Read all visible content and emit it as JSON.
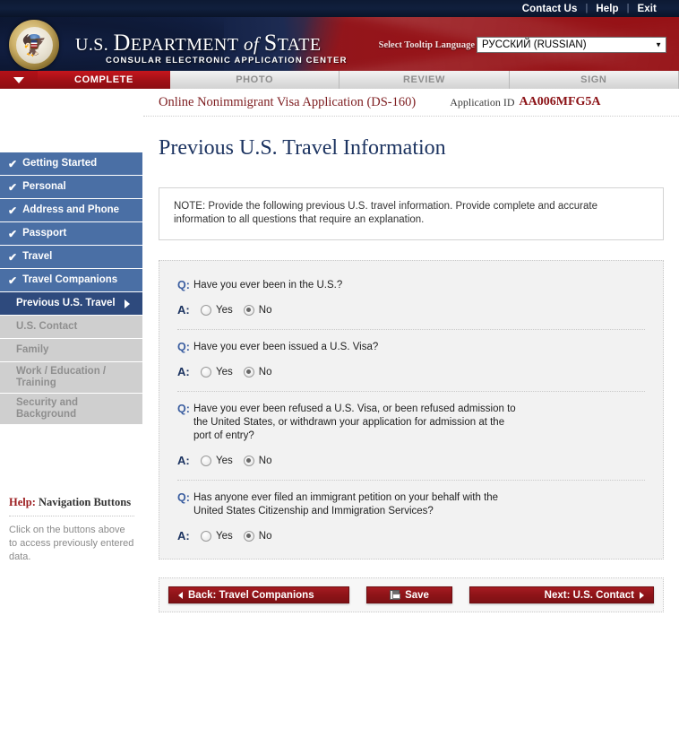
{
  "topbar": {
    "links": [
      "Contact Us",
      "Help",
      "Exit"
    ],
    "separator": "|"
  },
  "banner": {
    "title_prefix": "U.S. ",
    "title_department": "D",
    "title_department_rest": "EPARTMENT",
    "title_of": " of ",
    "title_state": "S",
    "title_state_rest": "TATE",
    "subtitle": "CONSULAR ELECTRONIC APPLICATION CENTER",
    "seal_icon": "great-seal-icon",
    "language_label": "Select Tooltip Language",
    "language_value": "РУССКИЙ (RUSSIAN)",
    "dropdown_icon": "chevron-down-icon"
  },
  "tabs": {
    "arrow_icon": "triangle-down-icon",
    "items": [
      {
        "label": "COMPLETE",
        "active": true
      },
      {
        "label": "PHOTO",
        "active": false
      },
      {
        "label": "REVIEW",
        "active": false
      },
      {
        "label": "SIGN",
        "active": false
      }
    ]
  },
  "sidebar": {
    "items": [
      {
        "label": "Getting Started",
        "state": "done"
      },
      {
        "label": "Personal",
        "state": "done"
      },
      {
        "label": "Address and Phone",
        "state": "done"
      },
      {
        "label": "Passport",
        "state": "done"
      },
      {
        "label": "Travel",
        "state": "done"
      },
      {
        "label": "Travel Companions",
        "state": "done"
      },
      {
        "label": "Previous U.S. Travel",
        "state": "active"
      },
      {
        "label": "U.S. Contact",
        "state": "todo"
      },
      {
        "label": "Family",
        "state": "todo"
      },
      {
        "label": "Work / Education / Training",
        "state": "todo"
      },
      {
        "label": "Security and Background",
        "state": "todo"
      }
    ],
    "check_glyph": "✔",
    "caret_icon": "caret-right-icon"
  },
  "help": {
    "title_prefix": "Help: ",
    "title_rest": "Navigation Buttons",
    "body": "Click on the buttons above to access previously entered data."
  },
  "header": {
    "app_name": "Online Nonimmigrant Visa Application (DS-160)",
    "app_id_label": "Application ID",
    "app_id_value": "AA006MFG5A"
  },
  "page": {
    "title": "Previous U.S. Travel Information",
    "note": "NOTE: Provide the following previous U.S. travel information. Provide complete and accurate information to all questions that require an explanation."
  },
  "questions": [
    {
      "q_marker": "Q:",
      "a_marker": "A:",
      "text": "Have you ever been in the U.S.?",
      "options": [
        {
          "label": "Yes",
          "checked": false
        },
        {
          "label": "No",
          "checked": true
        }
      ]
    },
    {
      "q_marker": "Q:",
      "a_marker": "A:",
      "text": "Have you ever been issued a U.S. Visa?",
      "options": [
        {
          "label": "Yes",
          "checked": false
        },
        {
          "label": "No",
          "checked": true
        }
      ]
    },
    {
      "q_marker": "Q:",
      "a_marker": "A:",
      "text": "Have you ever been refused a U.S. Visa, or been refused admission to the United States, or withdrawn your application for admission at the port of entry?",
      "options": [
        {
          "label": "Yes",
          "checked": false
        },
        {
          "label": "No",
          "checked": true
        }
      ]
    },
    {
      "q_marker": "Q:",
      "a_marker": "A:",
      "text": "Has anyone ever filed an immigrant petition on your behalf with the United States Citizenship and Immigration Services?",
      "options": [
        {
          "label": "Yes",
          "checked": false
        },
        {
          "label": "No",
          "checked": true
        }
      ]
    }
  ],
  "buttons": {
    "back": "Back: Travel Companions",
    "save": "Save",
    "next": "Next: U.S. Contact",
    "back_icon": "triangle-left-icon",
    "save_icon": "floppy-disk-icon",
    "next_icon": "triangle-right-icon"
  },
  "colors": {
    "brand_red": "#8f1418",
    "nav_blue": "#4a6fa5",
    "nav_active_blue": "#2e4a7d",
    "nav_todo_gray": "#cfcfcf",
    "title_navy": "#1d3461",
    "app_id_red": "#8b1216",
    "panel_gray": "#f2f2f2"
  }
}
